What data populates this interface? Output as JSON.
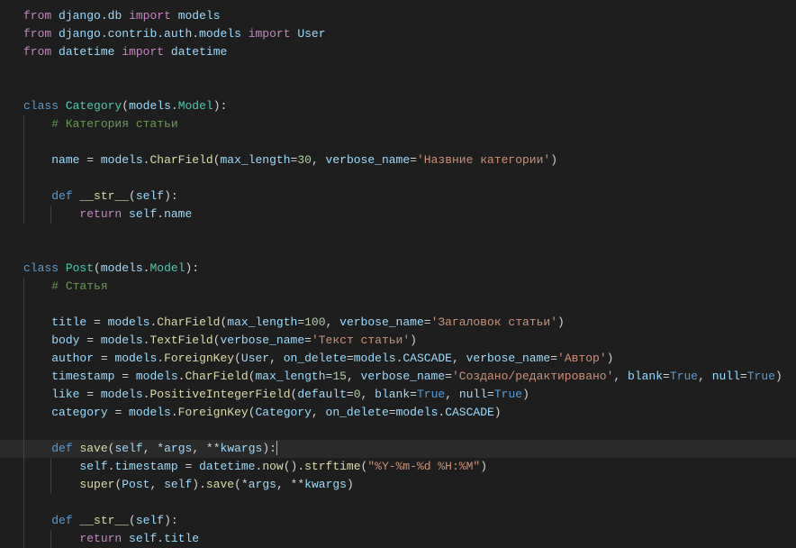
{
  "code": {
    "l1": {
      "import": "import",
      "from": "from",
      "m1": "django.db",
      "m2": "models"
    },
    "l2": {
      "from": "from",
      "m1": "django.contrib.auth.models",
      "import": "import",
      "m2": "User"
    },
    "l3": {
      "from": "from",
      "m1": "datetime",
      "import": "import",
      "m2": "datetime"
    },
    "l6": {
      "class": "class",
      "name": "Category",
      "p1": "models",
      "p2": "Model"
    },
    "l7": {
      "c": "# Категория статьи"
    },
    "l9": {
      "v": "name",
      "eq": " = ",
      "m": "models",
      "f": "CharField",
      "a1": "max_length",
      "n1": "30",
      "a2": "verbose_name",
      "s1": "'Назвние категории'"
    },
    "l11": {
      "def": "def",
      "fn": "__str__",
      "self": "self"
    },
    "l12": {
      "ret": "return",
      "self": "self",
      "attr": "name"
    },
    "l15": {
      "class": "class",
      "name": "Post",
      "p1": "models",
      "p2": "Model"
    },
    "l16": {
      "c": "# Статья"
    },
    "l18": {
      "v": "title",
      "m": "models",
      "f": "CharField",
      "a1": "max_length",
      "n1": "100",
      "a2": "verbose_name",
      "s1": "'Загаловок статьи'"
    },
    "l19": {
      "v": "body",
      "m": "models",
      "f": "TextField",
      "a1": "verbose_name",
      "s1": "'Текст статьи'"
    },
    "l20": {
      "v": "author",
      "m": "models",
      "f": "ForeignKey",
      "c1": "User",
      "a1": "on_delete",
      "m2": "models",
      "c2": "CASCADE",
      "a2": "verbose_name",
      "s1": "'Автор'"
    },
    "l21": {
      "v": "timestamp",
      "m": "models",
      "f": "CharField",
      "a1": "max_length",
      "n1": "15",
      "a2": "verbose_name",
      "s1": "'Создано/редактировано'",
      "a3": "blank",
      "t1": "True",
      "a4": "null",
      "t2": "True"
    },
    "l22": {
      "v": "like",
      "m": "models",
      "f": "PositiveIntegerField",
      "a1": "default",
      "n1": "0",
      "a2": "blank",
      "t1": "True",
      "a3": "null",
      "t2": "True"
    },
    "l23": {
      "v": "category",
      "m": "models",
      "f": "ForeignKey",
      "c1": "Category",
      "a1": "on_delete",
      "m2": "models",
      "c2": "CASCADE"
    },
    "l25": {
      "def": "def",
      "fn": "save",
      "self": "self",
      "args": "args",
      "kwargs": "kwargs"
    },
    "l26": {
      "self": "self",
      "attr": "timestamp",
      "d": "datetime",
      "now": "now",
      "strf": "strftime",
      "s1": "\"%Y-%m-%d %H:%M\""
    },
    "l27": {
      "super": "super",
      "c1": "Post",
      "self": "self",
      "save": "save",
      "args": "args",
      "kwargs": "kwargs"
    },
    "l29": {
      "def": "def",
      "fn": "__str__",
      "self": "self"
    },
    "l30": {
      "ret": "return",
      "self": "self",
      "attr": "title"
    }
  }
}
